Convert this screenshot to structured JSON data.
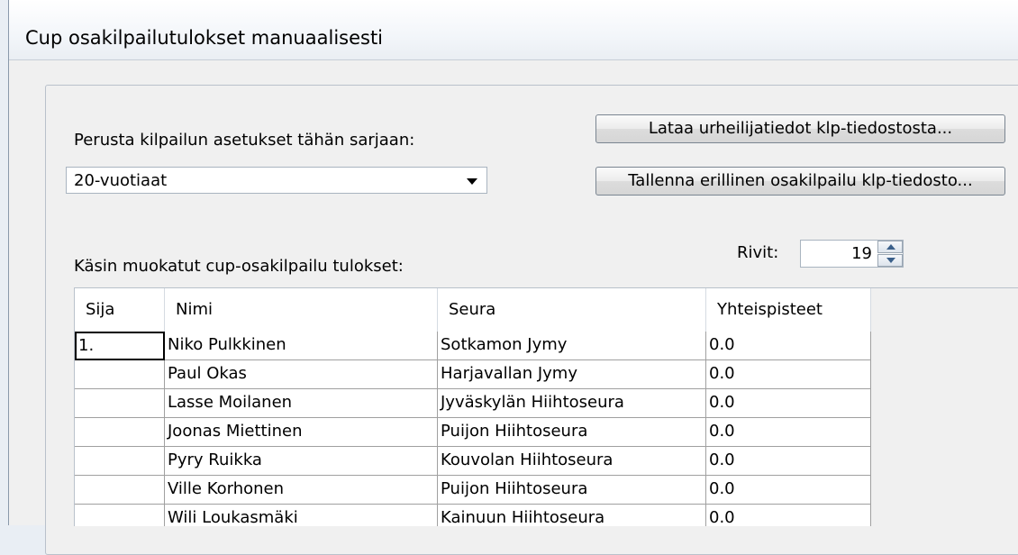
{
  "window": {
    "title": "Cup osakilpailutulokset manuaalisesti"
  },
  "settings": {
    "label": "Perusta kilpailun asetukset tähän sarjaan:",
    "series_value": "20-vuotiaat",
    "load_button": "Lataa urheilijatiedot klp-tiedostosta...",
    "save_button": "Tallenna erillinen osakilpailu klp-tiedosto..."
  },
  "results": {
    "label": "Käsin muokatut cup-osakilpailu tulokset:",
    "rows_label": "Rivit:",
    "rows_value": "19"
  },
  "table": {
    "columns": [
      "Sija",
      "Nimi",
      "Seura",
      "Yhteispisteet"
    ],
    "rows": [
      {
        "sija": "1.",
        "nimi": "Niko Pulkkinen",
        "seura": "Sotkamon Jymy",
        "pisteet": "0.0"
      },
      {
        "sija": "",
        "nimi": "Paul Okas",
        "seura": "Harjavallan Jymy",
        "pisteet": "0.0"
      },
      {
        "sija": "",
        "nimi": "Lasse Moilanen",
        "seura": "Jyväskylän Hiihtoseura",
        "pisteet": "0.0"
      },
      {
        "sija": "",
        "nimi": "Joonas Miettinen",
        "seura": "Puijon Hiihtoseura",
        "pisteet": "0.0"
      },
      {
        "sija": "",
        "nimi": "Pyry Ruikka",
        "seura": "Kouvolan Hiihtoseura",
        "pisteet": "0.0"
      },
      {
        "sija": "",
        "nimi": "Ville Korhonen",
        "seura": "Puijon Hiihtoseura",
        "pisteet": "0.0"
      },
      {
        "sija": "",
        "nimi": "Wili Loukasmäki",
        "seura": "Kainuun Hiihtoseura",
        "pisteet": "0.0"
      }
    ]
  },
  "colors": {
    "window_bg": "#f0f0f0",
    "selection_border": "#000000",
    "spin_arrow": "#3a5f8a"
  },
  "icons": {
    "dropdown": "chevron-down-icon",
    "spin_up": "arrow-up-icon",
    "spin_down": "arrow-down-icon"
  }
}
